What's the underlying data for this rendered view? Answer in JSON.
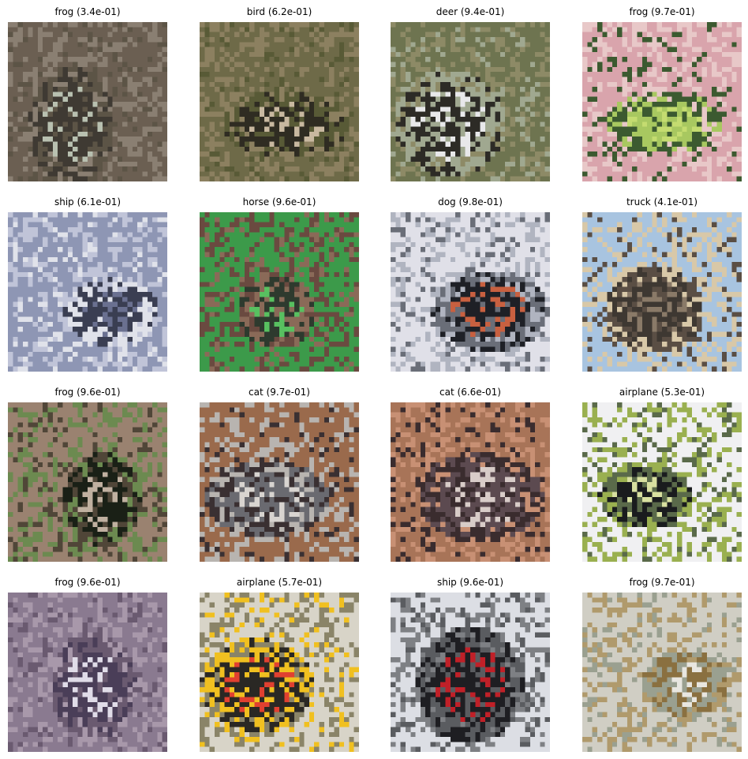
{
  "figure": {
    "panels": [
      {
        "label": "frog (3.4e-01)",
        "subject": "blurry low-resolution frog on brown ground",
        "palette": [
          "#6b5f52",
          "#8a7f72",
          "#3f3a33",
          "#b8c0b0",
          "#5c5446"
        ]
      },
      {
        "label": "bird (6.2e-01)",
        "subject": "blurry low-resolution bird among branches",
        "palette": [
          "#6e6a48",
          "#8c8060",
          "#2f2c22",
          "#c8b8a0",
          "#585a36"
        ]
      },
      {
        "label": "deer (9.4e-01)",
        "subject": "blurry low-resolution deer in grass",
        "palette": [
          "#6e7450",
          "#8d8a66",
          "#2d2b26",
          "#e8e8ea",
          "#a0a890"
        ]
      },
      {
        "label": "frog (9.7e-01)",
        "subject": "blurry low-resolution green frog on pink background",
        "palette": [
          "#d9a4ac",
          "#e8c8c8",
          "#a8c860",
          "#c4dc70",
          "#3c5a30"
        ]
      },
      {
        "label": "ship (6.1e-01)",
        "subject": "blurry low-resolution boat on water",
        "palette": [
          "#8e96b4",
          "#c0c4d8",
          "#3a3e52",
          "#6a7090",
          "#e0e2ea"
        ]
      },
      {
        "label": "horse (9.6e-01)",
        "subject": "blurry low-resolution horse on green background",
        "palette": [
          "#3c9a4a",
          "#6a4a40",
          "#2e3a2e",
          "#58c060",
          "#8a6a58"
        ]
      },
      {
        "label": "dog (9.8e-01)",
        "subject": "blurry low-resolution white dog",
        "palette": [
          "#e0e0e8",
          "#b0b4c0",
          "#1e2026",
          "#c86040",
          "#6a6e78"
        ]
      },
      {
        "label": "truck (4.1e-01)",
        "subject": "blurry low-resolution truck under sky",
        "palette": [
          "#a8c4e0",
          "#d8c8a8",
          "#3e3832",
          "#8a7a68",
          "#5a4e44"
        ]
      },
      {
        "label": "frog (9.6e-01)",
        "subject": "blurry low-resolution dark animal on ground",
        "palette": [
          "#9a8270",
          "#6c8a50",
          "#1a2016",
          "#c0b0a0",
          "#504638"
        ]
      },
      {
        "label": "cat (9.7e-01)",
        "subject": "blurry low-resolution grey cat face",
        "palette": [
          "#9a6a4c",
          "#b8b4b0",
          "#6a6a70",
          "#d8d4d0",
          "#3a3032"
        ]
      },
      {
        "label": "cat (6.6e-01)",
        "subject": "blurry low-resolution cat on brown background",
        "palette": [
          "#a87458",
          "#c89074",
          "#5c4a50",
          "#d8ccc8",
          "#3a2c2e"
        ]
      },
      {
        "label": "airplane (5.3e-01)",
        "subject": "blurry low-resolution object over green field",
        "palette": [
          "#f0f0f2",
          "#9ab050",
          "#1a1c1e",
          "#d8e0a0",
          "#5a6a4a"
        ]
      },
      {
        "label": "frog (9.6e-01)",
        "subject": "blurry low-resolution small animal on purple-grey background",
        "palette": [
          "#8a7a90",
          "#a898aa",
          "#4a3e58",
          "#e0dce8",
          "#6a5a70"
        ]
      },
      {
        "label": "airplane (5.7e-01)",
        "subject": "blurry low-resolution colorful figure outdoors",
        "palette": [
          "#d8d4c8",
          "#8a8468",
          "#2a2824",
          "#e04030",
          "#f0c020"
        ]
      },
      {
        "label": "ship (9.6e-01)",
        "subject": "blurry low-resolution red vehicle on road",
        "palette": [
          "#dcdee4",
          "#7e8084",
          "#1e1e22",
          "#c02028",
          "#5a5c60"
        ]
      },
      {
        "label": "frog (9.7e-01)",
        "subject": "blurry low-resolution brown frog on speckled ground",
        "palette": [
          "#d0cec4",
          "#b09a6c",
          "#8a7040",
          "#e8e6e0",
          "#9aa090"
        ]
      }
    ]
  }
}
